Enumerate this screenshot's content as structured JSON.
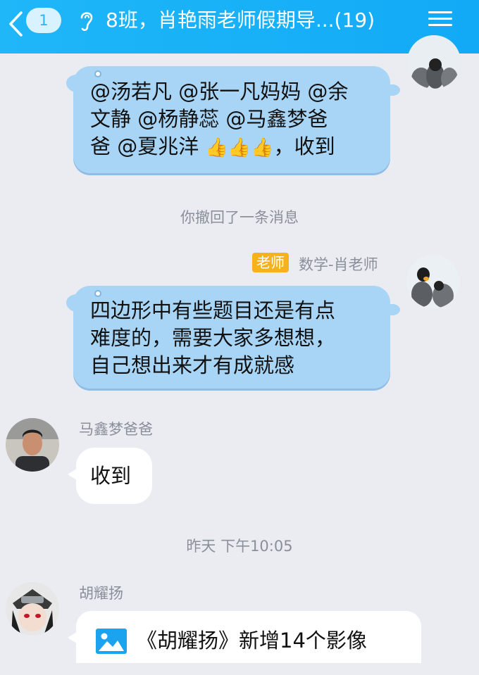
{
  "header": {
    "unread_count": "1",
    "title": "8班，肖艳雨老师假期导...(19)"
  },
  "messages": {
    "m1": {
      "text_line1": "@汤若凡 @张一凡妈妈 @余",
      "text_line2": "文静 @杨静蕊 @马鑫梦爸",
      "text_line3": "爸 @夏兆洋 ",
      "thumbs": "👍👍👍",
      "text_tail": "，收到"
    },
    "recall_notice": "你撤回了一条消息",
    "m2": {
      "role_badge": "老师",
      "sender": "数学-肖老师",
      "line1": "四边形中有些题目还是有点",
      "line2": "难度的，需要大家多想想，",
      "line3": "自己想出来才有成就感"
    },
    "m3": {
      "sender": "马鑫梦爸爸",
      "text": "收到"
    },
    "timestamp": "昨天 下午10:05",
    "m4": {
      "sender": "胡耀扬",
      "text": "《胡耀扬》新增14个影像"
    }
  },
  "colors": {
    "header": "#17b0f7",
    "blue_bubble": "#a8d5f6",
    "page_bg": "#eaecf2",
    "teacher_badge": "#f6b21b"
  }
}
